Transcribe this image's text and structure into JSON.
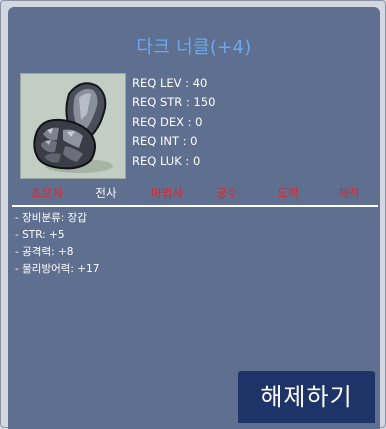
{
  "item": {
    "title": "다크 너클(+4)",
    "image_icon": "dark-knuckle-glove-icon",
    "requirements": [
      "REQ LEV : 40",
      "REQ STR : 150",
      "REQ DEX : 0",
      "REQ INT : 0",
      "REQ LUK : 0"
    ],
    "jobs": [
      {
        "label": "초보자",
        "allowed": false
      },
      {
        "label": "전사",
        "allowed": true
      },
      {
        "label": "마법사",
        "allowed": false
      },
      {
        "label": "궁수",
        "allowed": false
      },
      {
        "label": "도적",
        "allowed": false
      },
      {
        "label": "해적",
        "allowed": false
      }
    ],
    "stats": [
      "- 장비분류: 장갑",
      "- STR: +5",
      "- 공격력: +8",
      "- 물리방어력: +17"
    ]
  },
  "actions": {
    "release_label": "해제하기"
  },
  "colors": {
    "panel": "#5f6f8f",
    "title": "#6aa9ee",
    "job_disallowed": "#e0262e",
    "job_allowed": "#ffffff",
    "button": "#1e3468"
  }
}
